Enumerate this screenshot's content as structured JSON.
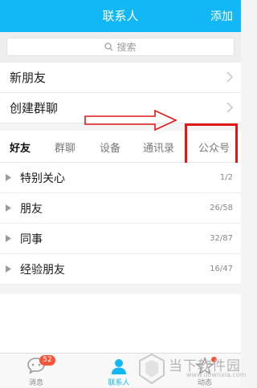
{
  "header": {
    "title": "联系人",
    "add_label": "添加"
  },
  "search": {
    "placeholder": "搜索"
  },
  "entries": [
    {
      "label": "新朋友"
    },
    {
      "label": "创建群聊"
    }
  ],
  "tabs": [
    {
      "label": "好友",
      "active": true
    },
    {
      "label": "群聊"
    },
    {
      "label": "设备"
    },
    {
      "label": "通讯录"
    },
    {
      "label": "公众号",
      "highlighted": true
    }
  ],
  "groups": [
    {
      "name": "特别关心",
      "count": "1/2"
    },
    {
      "name": "朋友",
      "count": "26/58"
    },
    {
      "name": "同事",
      "count": "32/87"
    },
    {
      "name": "经验朋友",
      "count": "16/47"
    }
  ],
  "bottom_nav": [
    {
      "label": "消息",
      "badge": "52",
      "icon": "chat-bubble-icon"
    },
    {
      "label": "联系人",
      "active": true,
      "icon": "person-icon"
    },
    {
      "label": "动态",
      "icon": "star-icon"
    }
  ],
  "watermark": {
    "text": "当下软件园",
    "url": "www.downxia.com"
  },
  "colors": {
    "accent": "#12b7f5",
    "annotation": "#e01818",
    "badge": "#f5553a"
  }
}
